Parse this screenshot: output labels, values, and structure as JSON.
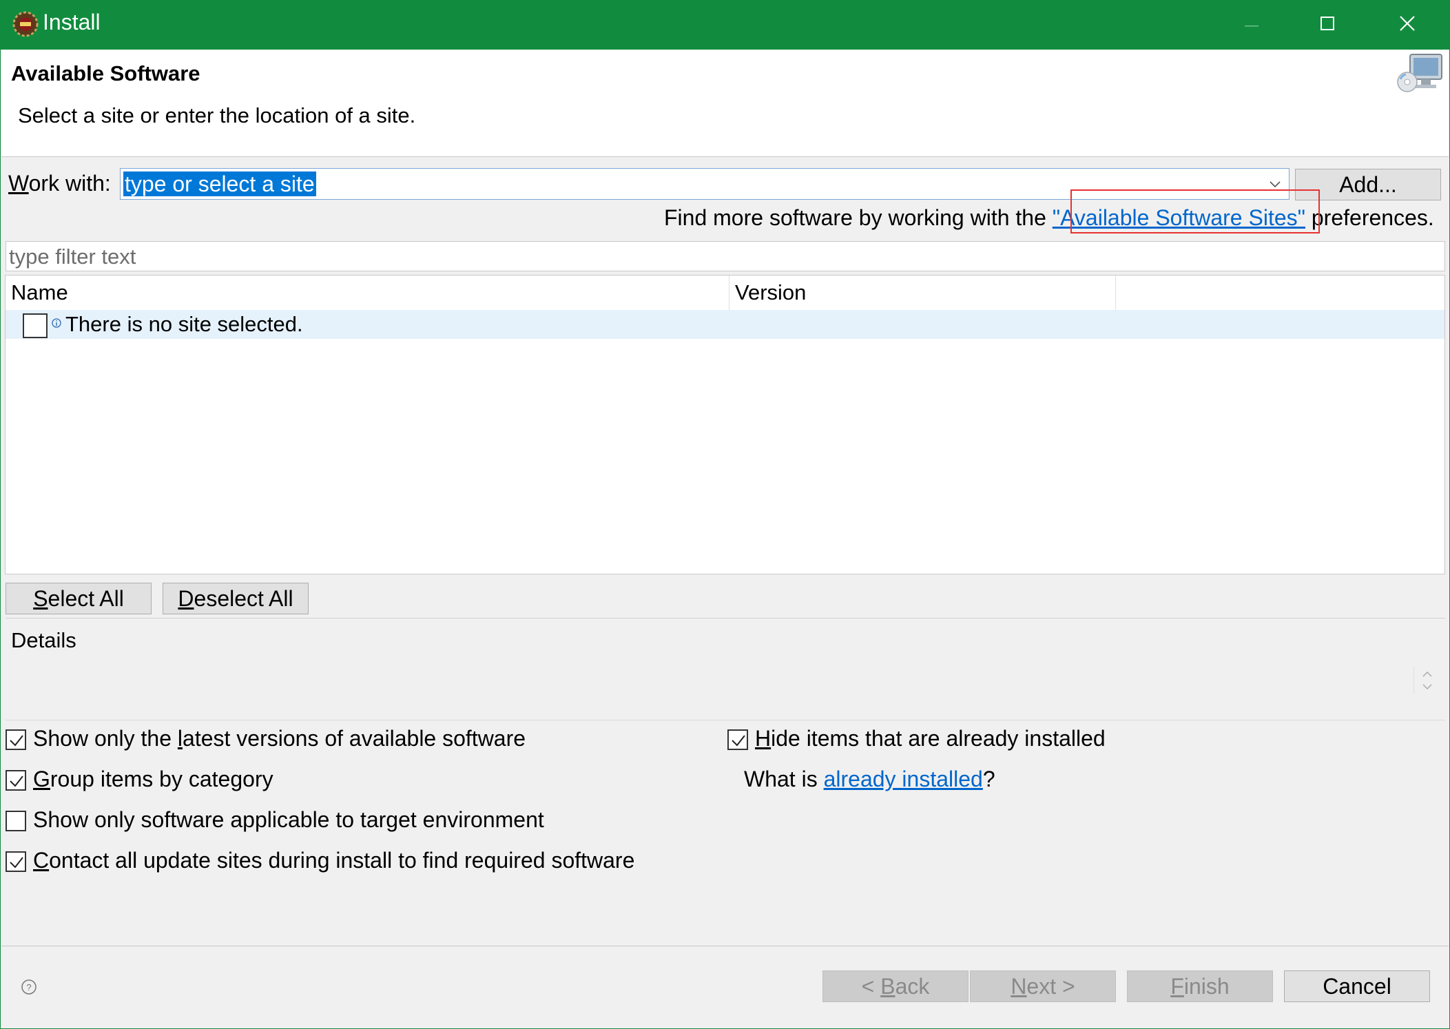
{
  "window": {
    "title": "Install",
    "theme_color": "#118c3e"
  },
  "header": {
    "title": "Available Software",
    "description": "Select a site or enter the location of a site."
  },
  "work_with": {
    "label_mnemonic": "W",
    "label_rest": "ork with:",
    "value": "type or select a site",
    "add_label": "Add..."
  },
  "find_more": {
    "prefix": "Find more software by working with the ",
    "link": "\"Available Software Sites\"",
    "suffix": " preferences."
  },
  "filter": {
    "placeholder": "type filter text"
  },
  "table": {
    "columns": [
      "Name",
      "Version"
    ],
    "rows": [
      {
        "text": "There is no site selected.",
        "checked": false
      }
    ]
  },
  "selection_buttons": {
    "select_all_mn": "S",
    "select_all_rest": "elect All",
    "deselect_all_mn": "D",
    "deselect_all_rest": "eselect All"
  },
  "details": {
    "label": "Details"
  },
  "options": {
    "latest_pre": "Show only the ",
    "latest_mn": "l",
    "latest_post": "atest versions of available software",
    "latest_checked": true,
    "group_mn": "G",
    "group_post": "roup items by category",
    "group_checked": true,
    "applicable": "Show only software applicable to target environment",
    "applicable_checked": false,
    "contact_mn": "C",
    "contact_post": "ontact all update sites during install to find required software",
    "contact_checked": true,
    "hide_mn": "H",
    "hide_post": "ide items that are already installed",
    "hide_checked": true,
    "what_is_prefix": "What is ",
    "what_is_link": "already installed",
    "what_is_suffix": "?"
  },
  "footer": {
    "back_pre": "< ",
    "back_mn": "B",
    "back_post": "ack",
    "next_mn": "N",
    "next_post": "ext >",
    "finish_mn": "F",
    "finish_post": "inish",
    "cancel": "Cancel"
  }
}
